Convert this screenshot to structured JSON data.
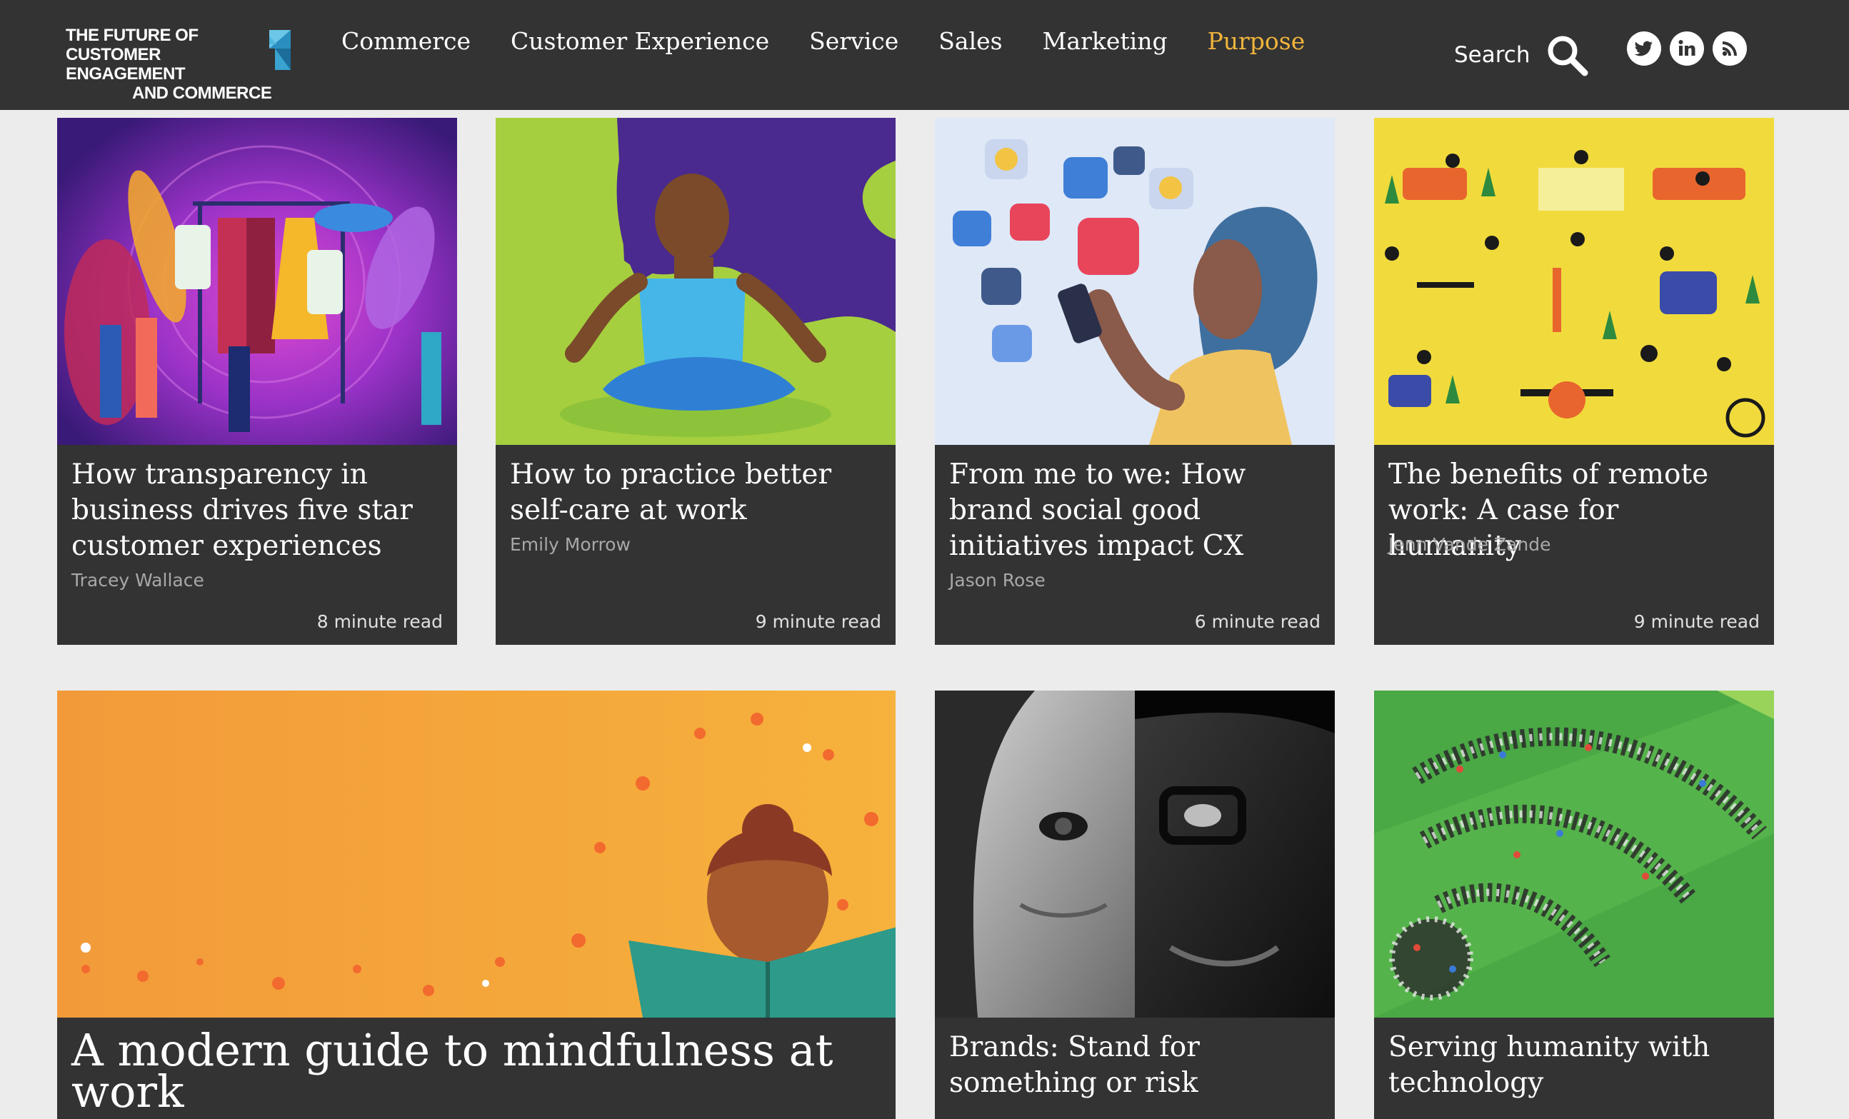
{
  "header": {
    "logo": {
      "line1": "THE FUTURE OF",
      "line2": "CUSTOMER ENGAGEMENT",
      "line3": "AND COMMERCE"
    },
    "nav": [
      {
        "label": "Commerce"
      },
      {
        "label": "Customer Experience"
      },
      {
        "label": "Service"
      },
      {
        "label": "Sales"
      },
      {
        "label": "Marketing"
      },
      {
        "label": "Purpose",
        "active": true
      }
    ],
    "search_label": "Search",
    "social": [
      "twitter-icon",
      "linkedin-icon",
      "rss-icon"
    ],
    "accent_color": "#f0b43c"
  },
  "articles": [
    {
      "title": "How transparency in business drives five star customer experiences",
      "author": "Tracey Wallace",
      "read_time": "8 minute read",
      "image": "fashion-rack-illustration"
    },
    {
      "title": "How to practice better self-care at work",
      "author": "Emily Morrow",
      "read_time": "9 minute read",
      "image": "meditating-woman-illustration"
    },
    {
      "title": "From me to we: How brand social good initiatives impact CX",
      "author": "Jason Rose",
      "read_time": "6 minute read",
      "image": "woman-phone-social-illustration"
    },
    {
      "title": "The benefits of remote work: A case for humanity",
      "author": "Jenn Vande Zande",
      "read_time": "9 minute read",
      "image": "remote-workers-illustration"
    },
    {
      "title": "A modern guide to mindfulness at work",
      "image": "reading-girl-illustration"
    },
    {
      "title": "Brands: Stand for something or risk",
      "image": "faces-photo"
    },
    {
      "title": "Serving humanity with technology",
      "image": "crowd-wifi-illustration"
    }
  ]
}
